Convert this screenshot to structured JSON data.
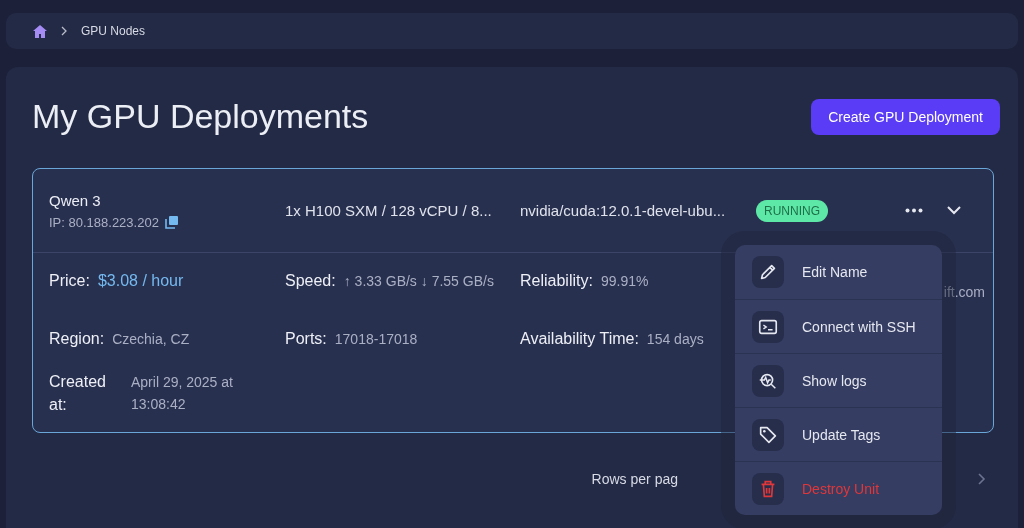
{
  "breadcrumb": {
    "items": [
      "GPU Nodes"
    ]
  },
  "page": {
    "title": "My GPU Deployments",
    "create_button": "Create GPU Deployment"
  },
  "deployments": [
    {
      "name": "Qwen 3",
      "ip": "IP: 80.188.223.202",
      "spec": "1x H100 SXM / 128 vCPU / 8...",
      "image": "nvidia/cuda:12.0.1-devel-ubu...",
      "status": "RUNNING",
      "expanded": true,
      "details": [
        {
          "label": "Price:",
          "value": "$3.08 / hour",
          "highlight": true
        },
        {
          "label": "Speed:",
          "value": "↑ 3.33 GB/s ↓ 7.55 GB/s",
          "highlight": false
        },
        {
          "label": "Reliability:",
          "value": "99.91%",
          "highlight": false
        },
        {
          "label": "Region:",
          "value": "Czechia, CZ",
          "highlight": false
        },
        {
          "label": "Ports:",
          "value": "17018-17018",
          "highlight": false
        },
        {
          "label": "Availability Time:",
          "value": "154 days",
          "highlight": false
        },
        {
          "label": "Created at:",
          "value": "April 29, 2025 at 13:08:42",
          "highlight": false
        }
      ],
      "hidden_value": "ift.com"
    }
  ],
  "menu": {
    "items": [
      {
        "label": "Edit Name",
        "kind": "normal"
      },
      {
        "label": "Connect with SSH",
        "kind": "normal"
      },
      {
        "label": "Show logs",
        "kind": "normal"
      },
      {
        "label": "Update Tags",
        "kind": "normal"
      },
      {
        "label": "Destroy Unit",
        "kind": "danger"
      }
    ]
  },
  "pagination": {
    "rows_per_page": "Rows per pag"
  }
}
